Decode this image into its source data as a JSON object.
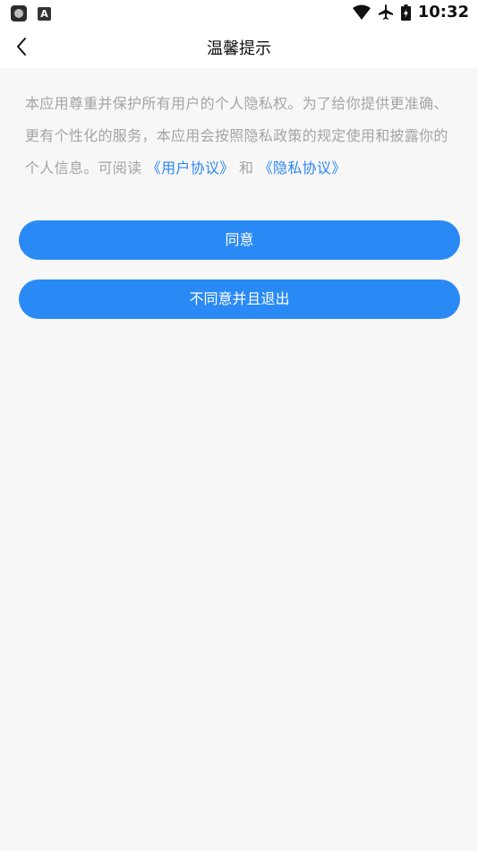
{
  "status_bar": {
    "left_icons": [
      "app-notification-icon",
      "a-notification-icon"
    ],
    "a_glyph": "A",
    "right_icons": [
      "wifi-icon",
      "airplane-icon",
      "battery-icon"
    ],
    "time": "10:32"
  },
  "nav": {
    "back_icon": "chevron-left-icon",
    "title": "温馨提示"
  },
  "notice": {
    "text": "本应用尊重并保护所有用户的个人隐私权。为了给你提供更准确、更有个性化的服务，本应用会按照隐私政策的规定使用和披露你的个人信息。可阅读 ",
    "user_agreement": "《用户协议》",
    "and": " 和 ",
    "privacy_agreement": "《隐私协议》"
  },
  "buttons": {
    "agree": "同意",
    "decline": "不同意并且退出"
  },
  "colors": {
    "accent": "#2a8af5",
    "link": "#2b87ef",
    "body_text": "#a4a4a4",
    "background": "#f7f7f8"
  }
}
